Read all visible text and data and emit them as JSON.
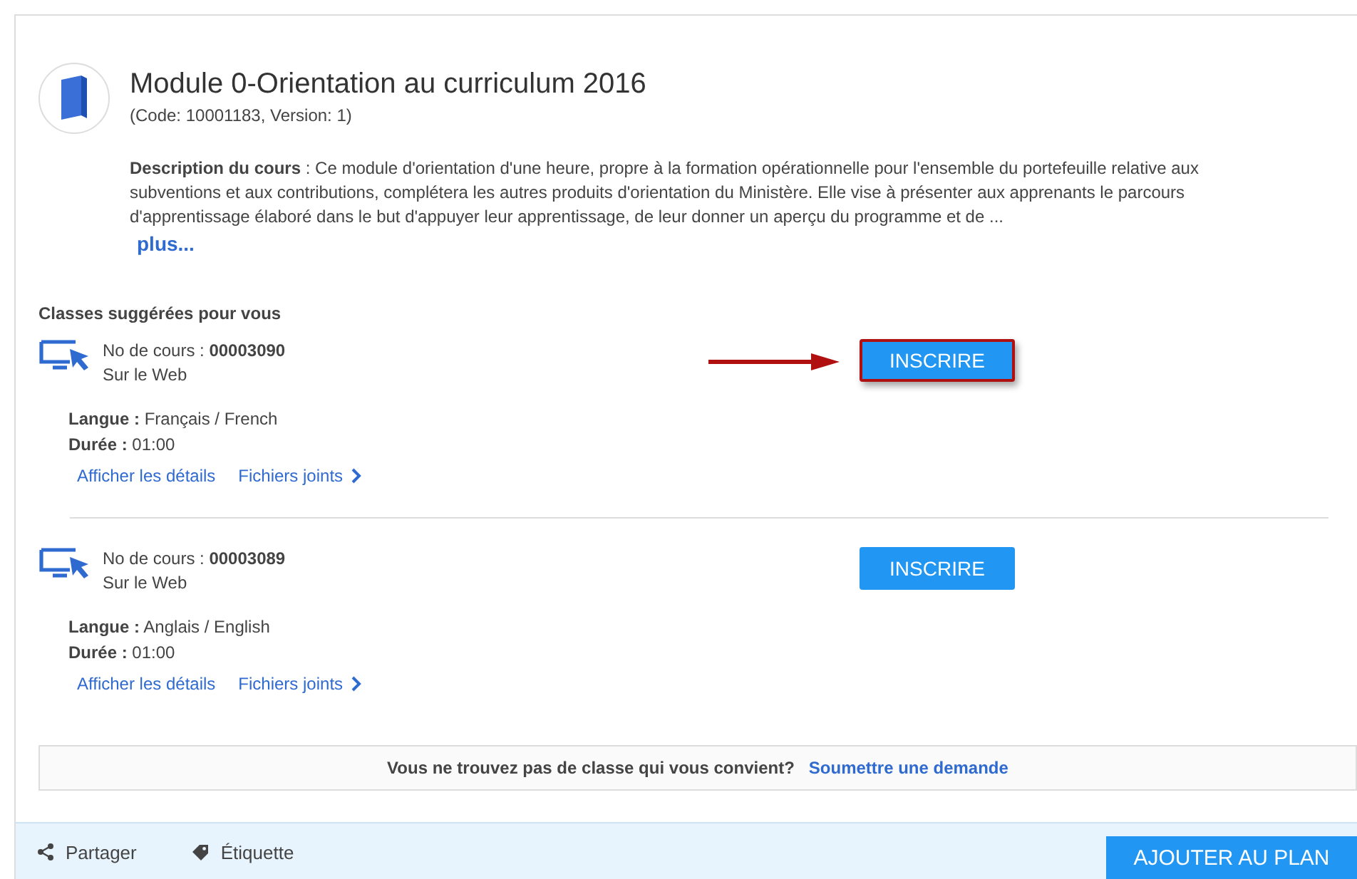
{
  "course": {
    "title": "Module 0-Orientation au curriculum 2016",
    "code": "(Code: 10001183, Version: 1)",
    "description": "**Description du cours** : Ce module d'orientation d'une heure, propre à la formation opérationnelle pour l'ensemble du portefeuille relative aux subventions et aux contributions, complétera les autres produits d'orientation du Ministère. Elle vise à présenter aux apprenants le parcours d'apprentissage élaboré dans le but d'appuyer leur apprentissage, de leur donner un aperçu du programme et de ...",
    "more": "plus..."
  },
  "classes_heading": "Classes suggérées pour vous",
  "classes": [
    {
      "number": "No de cours : **00003090**",
      "delivery": "Sur le Web",
      "language": "**Langue :** Français / French",
      "duration": "**Durée :** 01:00",
      "details_link": "Afficher les détails",
      "files_link": "Fichiers joints",
      "button": "INSCRIRE",
      "highlighted": true
    },
    {
      "number": "No de cours : **00003089**",
      "delivery": "Sur le Web",
      "language": "**Langue :** Anglais / English",
      "duration": "**Durée :** 01:00",
      "details_link": "Afficher les détails",
      "files_link": "Fichiers joints",
      "button": "INSCRIRE",
      "highlighted": false
    }
  ],
  "request_bar": {
    "question": "Vous ne trouvez pas de classe qui vous convient?",
    "link": "Soumettre une demande"
  },
  "footer": {
    "share": "Partager",
    "tag": "Étiquette",
    "add_button": "AJOUTER AU PLAN"
  }
}
